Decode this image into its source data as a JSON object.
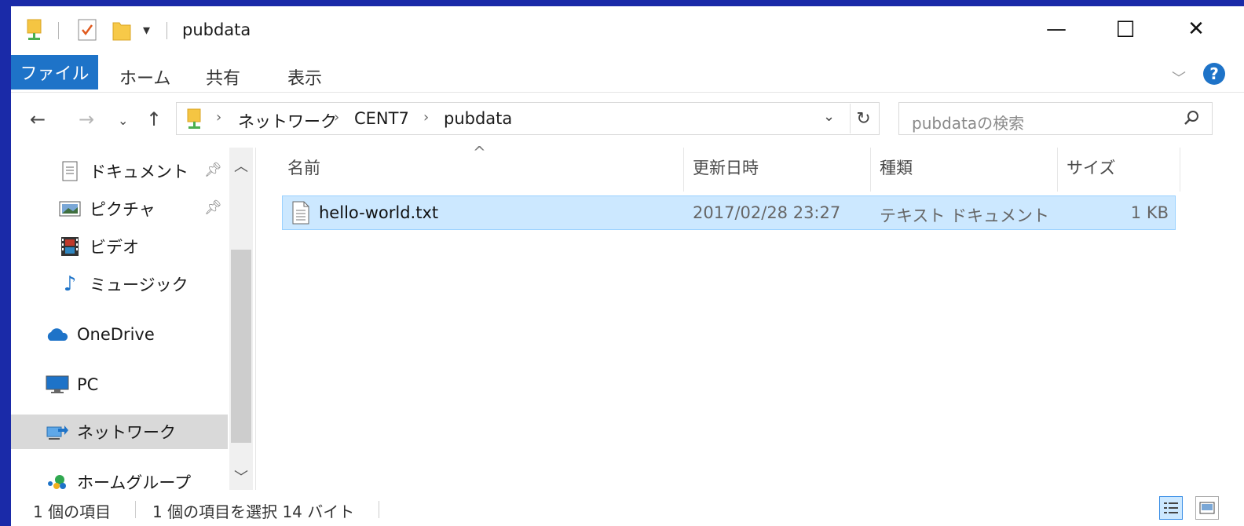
{
  "window": {
    "title": "pubdata",
    "controls": {
      "minimize": "—",
      "maximize": "☐",
      "close": "✕"
    }
  },
  "ribbon": {
    "tabs": [
      "ファイル",
      "ホーム",
      "共有",
      "表示"
    ],
    "help": "?"
  },
  "address": {
    "crumbs": [
      "ネットワーク",
      "CENT7",
      "pubdata"
    ],
    "separator": "›"
  },
  "search": {
    "placeholder": "pubdataの検索"
  },
  "sidebar": {
    "items": [
      {
        "label": "ドキュメント",
        "icon": "documents-icon",
        "pinned": true
      },
      {
        "label": "ピクチャ",
        "icon": "pictures-icon",
        "pinned": true
      },
      {
        "label": "ビデオ",
        "icon": "videos-icon",
        "pinned": false
      },
      {
        "label": "ミュージック",
        "icon": "music-icon",
        "pinned": false
      },
      {
        "label": "OneDrive",
        "icon": "onedrive-icon",
        "pinned": false
      },
      {
        "label": "PC",
        "icon": "pc-icon",
        "pinned": false
      },
      {
        "label": "ネットワーク",
        "icon": "network-icon",
        "pinned": false,
        "selected": true
      },
      {
        "label": "ホームグループ",
        "icon": "homegroup-icon",
        "pinned": false
      }
    ]
  },
  "files": {
    "columns": [
      "名前",
      "更新日時",
      "種類",
      "サイズ"
    ],
    "rows": [
      {
        "name": "hello-world.txt",
        "modified": "2017/02/28 23:27",
        "type": "テキスト ドキュメント",
        "size": "1 KB",
        "selected": true
      }
    ]
  },
  "status": {
    "count": "1 個の項目",
    "selection": "1 個の項目を選択 14 バイト"
  },
  "colors": {
    "accent": "#1e73c8",
    "selection": "#cce8ff",
    "frame": "#1a2aa8"
  }
}
